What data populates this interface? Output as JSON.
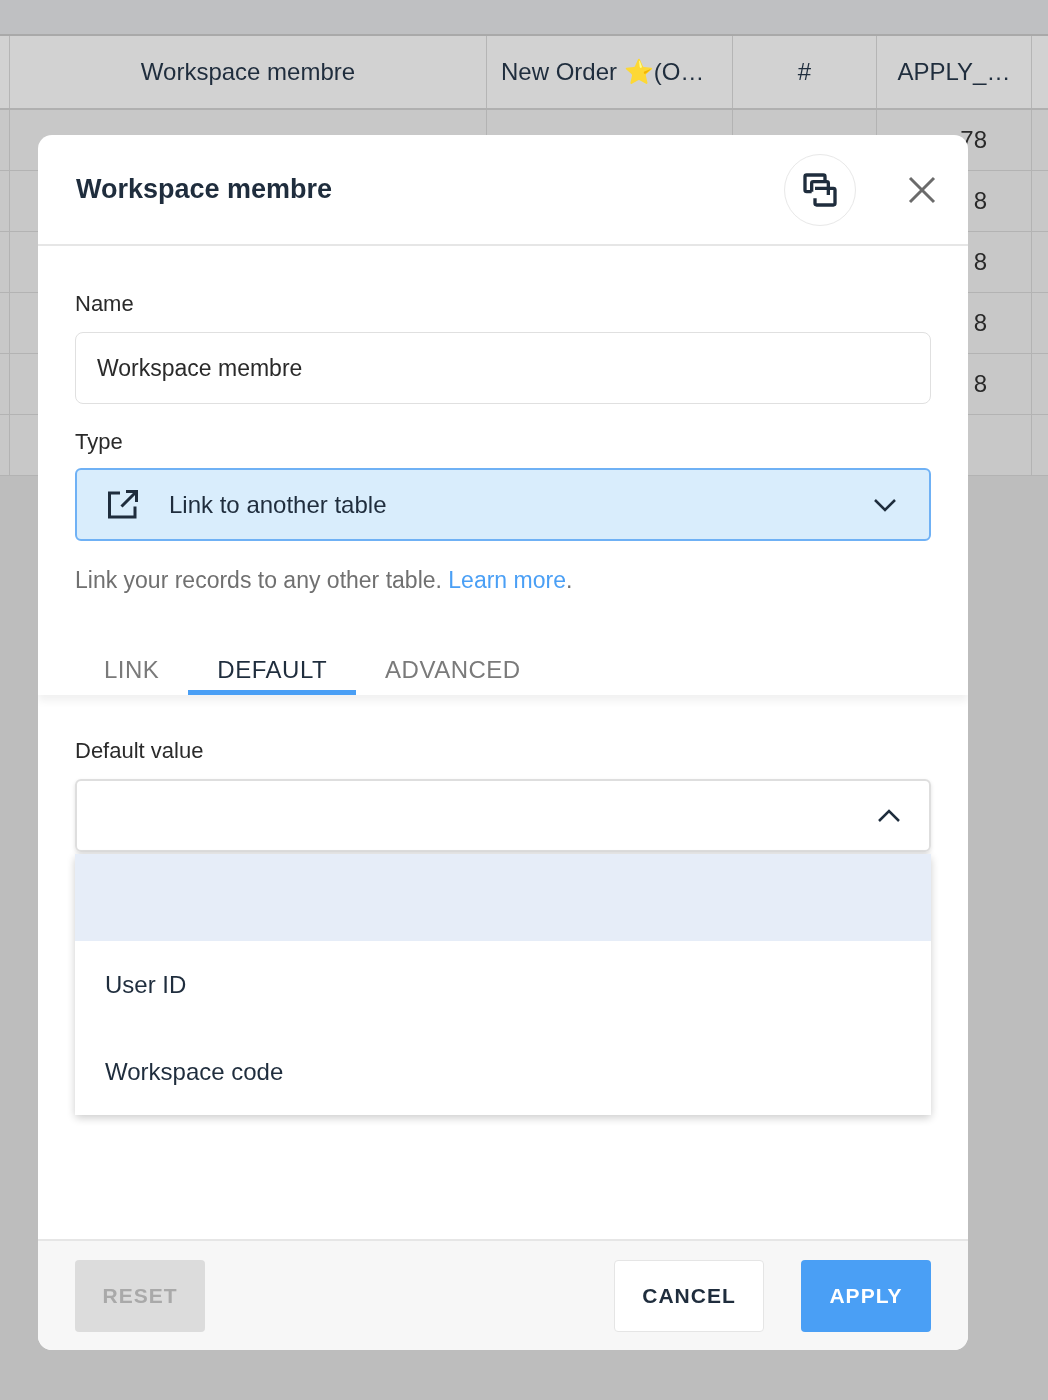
{
  "table": {
    "columns": [
      "Workspace membre",
      "New Order ⭐(O…",
      "#",
      "APPLY_…"
    ],
    "rows": [
      {
        "column_4": "78"
      },
      {
        "column_4": "8"
      },
      {
        "column_4": "8"
      },
      {
        "column_4": "8"
      },
      {
        "column_4": "8"
      },
      {}
    ]
  },
  "dialog": {
    "title": "Workspace membre",
    "name_label": "Name",
    "name_value": "Workspace membre",
    "type_label": "Type",
    "type_value": "Link to another table",
    "help": "Link your records to any other table. ",
    "help_link": "Learn more",
    "help_end": ".",
    "tabs": [
      {
        "label": "LINK",
        "selected": false
      },
      {
        "label": "DEFAULT",
        "selected": true
      },
      {
        "label": "ADVANCED",
        "selected": false
      }
    ],
    "default_label": "Default value",
    "default_expanded": true,
    "options": [
      {
        "selected": true
      },
      {
        "label": "User ID",
        "selected": false
      },
      {
        "label": "Workspace code",
        "selected": false
      }
    ],
    "buttons": [
      {
        "label": "RESET",
        "kind": "reset",
        "disabled": true
      },
      {
        "label": "CANCEL",
        "kind": "cancel",
        "disabled": false
      },
      {
        "label": "APPLY",
        "kind": "apply",
        "disabled": false
      }
    ]
  }
}
